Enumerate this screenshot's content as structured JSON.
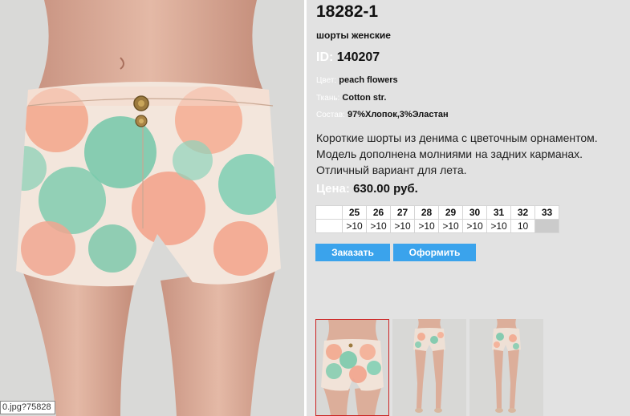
{
  "product": {
    "title": "18282-1",
    "subtitle": "шорты женские",
    "id_label": "ID:",
    "id_value": "140207",
    "color_label": "Цвет:",
    "color_value": "peach flowers",
    "fabric_label": "Ткань:",
    "fabric_value": "Cotton str.",
    "composition_label": "Состав:",
    "composition_value": "97%Хлопок,3%Эластан",
    "description": "Короткие шорты из денима с цветочным орнаментом. Модель дополнена молниями на задних карманах. Отличный вариант для лета.",
    "price_label": "Цена:",
    "price_value": "630.00 руб."
  },
  "sizes": {
    "labels": [
      "25",
      "26",
      "27",
      "28",
      "29",
      "30",
      "31",
      "32",
      "33"
    ],
    "stock": [
      ">10",
      ">10",
      ">10",
      ">10",
      ">10",
      ">10",
      ">10",
      "10",
      ""
    ]
  },
  "buttons": {
    "order": "Заказать",
    "checkout": "Оформить"
  },
  "photo": {
    "url_tooltip": "0.jpg?75828"
  },
  "colors": {
    "accent": "#3aa3ec",
    "selected_border": "#cc2222",
    "page_bg": "#e2e2e2"
  }
}
